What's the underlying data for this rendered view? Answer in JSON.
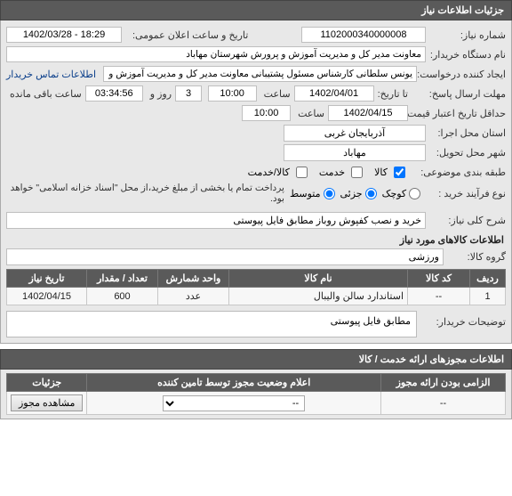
{
  "section_header": "جزئیات اطلاعات نیاز",
  "labels": {
    "need_no": "شماره نیاز:",
    "announce_dt": "تاریخ و ساعت اعلان عمومی:",
    "buyer_org": "نام دستگاه خریدار:",
    "request_creator": "ایجاد کننده درخواست:",
    "contact": "اطلاعات تماس خریدار",
    "send_deadline": "مهلت ارسال پاسخ:",
    "until_date": "تا تاریخ:",
    "saat": "ساعت",
    "ruz_va": "روز و",
    "saat_baghi": "ساعت باقی مانده",
    "min_validity": "حداقل تاریخ اعتبار قیمت: تا تاریخ:",
    "exec_province": "استان محل اجرا:",
    "delivery_city": "شهر محل تحویل:",
    "category": "طبقه بندی موضوعی:",
    "kala": "کالا",
    "khadamat": "خدمت",
    "kala_khadamat": "کالا/خدمت",
    "purchase_type": "نوع فرآیند خرید :",
    "kuchak": "کوچک",
    "jozi": "جزئی",
    "motavaset": "متوسط",
    "payment_note": "پرداخت تمام یا بخشی از مبلغ خرید،از محل \"اسناد خزانه اسلامی\" خواهد بود.",
    "need_desc": "شرح کلی نیاز:",
    "sub_items": "اطلاعات کالاهای مورد نیاز",
    "goods_group": "گروه کالا:",
    "buyer_notes": "توضیحات خریدار:",
    "permits_header": "اطلاعات مجوزهای ارائه خدمت / کالا",
    "view_permit_btn": "مشاهده مجوز"
  },
  "values": {
    "need_no": "1102000340000008",
    "announce_dt": "18:29 - 1402/03/28",
    "buyer_org": "معاونت مدیر کل و مدیریت آموزش و پرورش شهرستان مهاباد",
    "request_creator": "یونس سلطانی کارشناس مسئول پشتیبانی معاونت مدیر کل و مدیریت آموزش و",
    "deadline_date": "1402/04/01",
    "deadline_time": "10:00",
    "days_left": "3",
    "time_left": "03:34:56",
    "validity_date": "1402/04/15",
    "validity_time": "10:00",
    "province": "آذربایجان غربی",
    "city": "مهاباد",
    "need_desc_txt": "خرید و نصب کفپوش روباز مطابق فایل پیوستی",
    "goods_group": "ورزشی",
    "buyer_notes_txt": "مطابق فایل پیوستی"
  },
  "table": {
    "headers": {
      "row": "ردیف",
      "code": "کد کالا",
      "name": "نام کالا",
      "unit": "واحد شمارش",
      "qty": "تعداد / مقدار",
      "date": "تاریخ نیاز"
    },
    "rows": [
      {
        "row": "1",
        "code": "--",
        "name": "استاندارد سالن والیبال",
        "unit": "عدد",
        "qty": "600",
        "date": "1402/04/15"
      }
    ]
  },
  "permits": {
    "headers": {
      "mandatory": "الزامی بودن ارائه مجوز",
      "status": "اعلام وضعیت مجوز توسط تامین کننده",
      "details": "جزئیات"
    },
    "rows": [
      {
        "mandatory": "--",
        "status": "--"
      }
    ]
  },
  "category_state": {
    "kala": true,
    "khadamat": false,
    "kala_khadamat": false
  },
  "purchase_state": {
    "jozi": true,
    "motavaset": true
  }
}
